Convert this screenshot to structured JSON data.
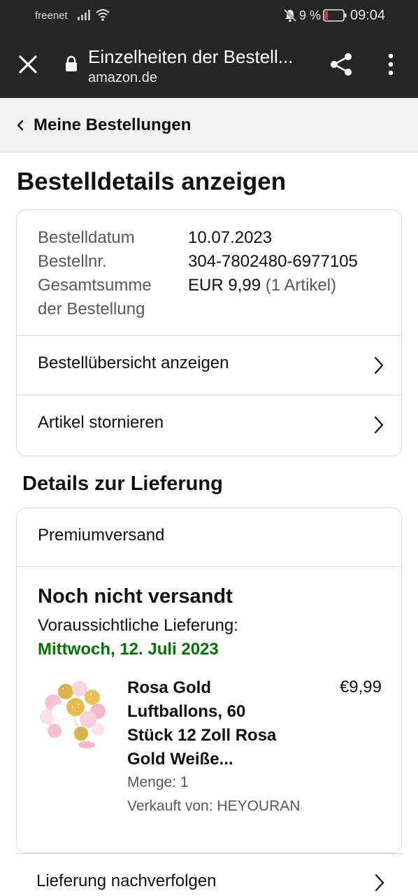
{
  "status_bar": {
    "carrier": "freenet",
    "battery_percent": "9 %",
    "time": "09:04",
    "icons": [
      "signal-icon",
      "wifi-icon",
      "bell-muted-icon",
      "battery-low-icon"
    ],
    "battery_color": "#e53935"
  },
  "browser_bar": {
    "title": "Einzelheiten der Bestell...",
    "url": "amazon.de",
    "icons": [
      "close-icon",
      "lock-icon",
      "share-icon",
      "more-vert-icon"
    ]
  },
  "breadcrumb": {
    "label": "Meine Bestellungen"
  },
  "page": {
    "title": "Bestelldetails anzeigen"
  },
  "order_info": {
    "date_label": "Bestelldatum",
    "date_value": "10.07.2023",
    "number_label": "Bestellnr.",
    "number_value": "304-7802480-6977105",
    "total_label_line1": "Gesamtsumme",
    "total_label_line2": "der Bestellung",
    "total_value": "EUR 9,99",
    "total_items": "(1 Artikel)"
  },
  "order_actions": {
    "summary": "Bestellübersicht anzeigen",
    "cancel": "Artikel stornieren"
  },
  "delivery": {
    "section_title": "Details zur Lieferung",
    "shipping_method": "Premiumversand",
    "status": "Noch nicht versandt",
    "estimate_label": "Voraussichtliche Lieferung:",
    "estimate_date": "Mittwoch, 12. Juli 2023",
    "estimate_color": "#007600",
    "product": {
      "title_line1": "Rosa Gold",
      "title_line2": "Luftballons, 60",
      "title_line3": "Stück 12 Zoll Rosa",
      "title_line4": "Gold Weiße...",
      "price": "€9,99",
      "quantity": "Menge: 1",
      "seller": "Verkauft von: HEYOURAN"
    },
    "track": "Lieferung nachverfolgen"
  }
}
